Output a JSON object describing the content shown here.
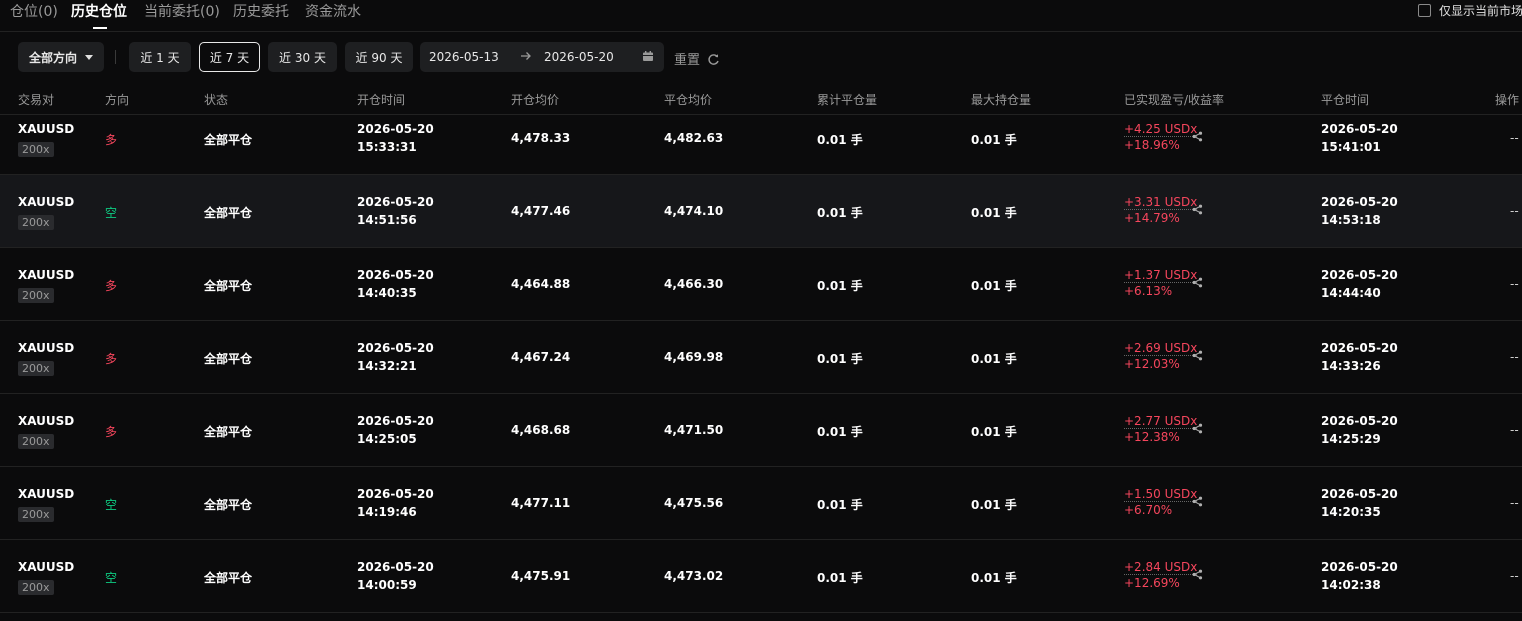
{
  "tabs": [
    {
      "label": "仓位(0)"
    },
    {
      "label": "历史仓位"
    },
    {
      "label": "当前委托(0)"
    },
    {
      "label": "历史委托"
    },
    {
      "label": "资金流水"
    }
  ],
  "only_current_market_label": "仅显示当前市场",
  "filters": {
    "direction": "全部方向",
    "ranges": [
      "近 1 天",
      "近 7 天",
      "近 30 天",
      "近 90 天"
    ],
    "selected_range": "近 7 天",
    "date_from": "2026-05-13",
    "date_to": "2026-05-20",
    "reset": "重置"
  },
  "columns": [
    "交易对",
    "方向",
    "状态",
    "开仓时间",
    "开仓均价",
    "平仓均价",
    "累计平仓量",
    "最大持仓量",
    "已实现盈亏/收益率",
    "平仓时间",
    "操作"
  ],
  "rows": [
    {
      "symbol": "XAUUSD",
      "leverage": "200x",
      "side": "多",
      "side_type": "long",
      "status": "全部平仓",
      "open_date": "2026-05-20",
      "open_time": "15:33:31",
      "open_price": "4,478.33",
      "close_price": "4,482.63",
      "closed_qty": "0.01 手",
      "max_qty": "0.01 手",
      "pnl": "+4.25 USDx",
      "roi": "+18.96%",
      "close_date": "2026-05-20",
      "close_time": "15:41:01",
      "action": "--"
    },
    {
      "symbol": "XAUUSD",
      "leverage": "200x",
      "side": "空",
      "side_type": "short",
      "status": "全部平仓",
      "open_date": "2026-05-20",
      "open_time": "14:51:56",
      "open_price": "4,477.46",
      "close_price": "4,474.10",
      "closed_qty": "0.01 手",
      "max_qty": "0.01 手",
      "pnl": "+3.31 USDx",
      "roi": "+14.79%",
      "close_date": "2026-05-20",
      "close_time": "14:53:18",
      "action": "--"
    },
    {
      "symbol": "XAUUSD",
      "leverage": "200x",
      "side": "多",
      "side_type": "long",
      "status": "全部平仓",
      "open_date": "2026-05-20",
      "open_time": "14:40:35",
      "open_price": "4,464.88",
      "close_price": "4,466.30",
      "closed_qty": "0.01 手",
      "max_qty": "0.01 手",
      "pnl": "+1.37 USDx",
      "roi": "+6.13%",
      "close_date": "2026-05-20",
      "close_time": "14:44:40",
      "action": "--"
    },
    {
      "symbol": "XAUUSD",
      "leverage": "200x",
      "side": "多",
      "side_type": "long",
      "status": "全部平仓",
      "open_date": "2026-05-20",
      "open_time": "14:32:21",
      "open_price": "4,467.24",
      "close_price": "4,469.98",
      "closed_qty": "0.01 手",
      "max_qty": "0.01 手",
      "pnl": "+2.69 USDx",
      "roi": "+12.03%",
      "close_date": "2026-05-20",
      "close_time": "14:33:26",
      "action": "--"
    },
    {
      "symbol": "XAUUSD",
      "leverage": "200x",
      "side": "多",
      "side_type": "long",
      "status": "全部平仓",
      "open_date": "2026-05-20",
      "open_time": "14:25:05",
      "open_price": "4,468.68",
      "close_price": "4,471.50",
      "closed_qty": "0.01 手",
      "max_qty": "0.01 手",
      "pnl": "+2.77 USDx",
      "roi": "+12.38%",
      "close_date": "2026-05-20",
      "close_time": "14:25:29",
      "action": "--"
    },
    {
      "symbol": "XAUUSD",
      "leverage": "200x",
      "side": "空",
      "side_type": "short",
      "status": "全部平仓",
      "open_date": "2026-05-20",
      "open_time": "14:19:46",
      "open_price": "4,477.11",
      "close_price": "4,475.56",
      "closed_qty": "0.01 手",
      "max_qty": "0.01 手",
      "pnl": "+1.50 USDx",
      "roi": "+6.70%",
      "close_date": "2026-05-20",
      "close_time": "14:20:35",
      "action": "--"
    },
    {
      "symbol": "XAUUSD",
      "leverage": "200x",
      "side": "空",
      "side_type": "short",
      "status": "全部平仓",
      "open_date": "2026-05-20",
      "open_time": "14:00:59",
      "open_price": "4,475.91",
      "close_price": "4,473.02",
      "closed_qty": "0.01 手",
      "max_qty": "0.01 手",
      "pnl": "+2.84 USDx",
      "roi": "+12.69%",
      "close_date": "2026-05-20",
      "close_time": "14:02:38",
      "action": "--"
    }
  ],
  "colors": {
    "long": "#f6465d",
    "short": "#0ecb81",
    "profit": "#f6465d",
    "background": "#0b0b0c"
  }
}
